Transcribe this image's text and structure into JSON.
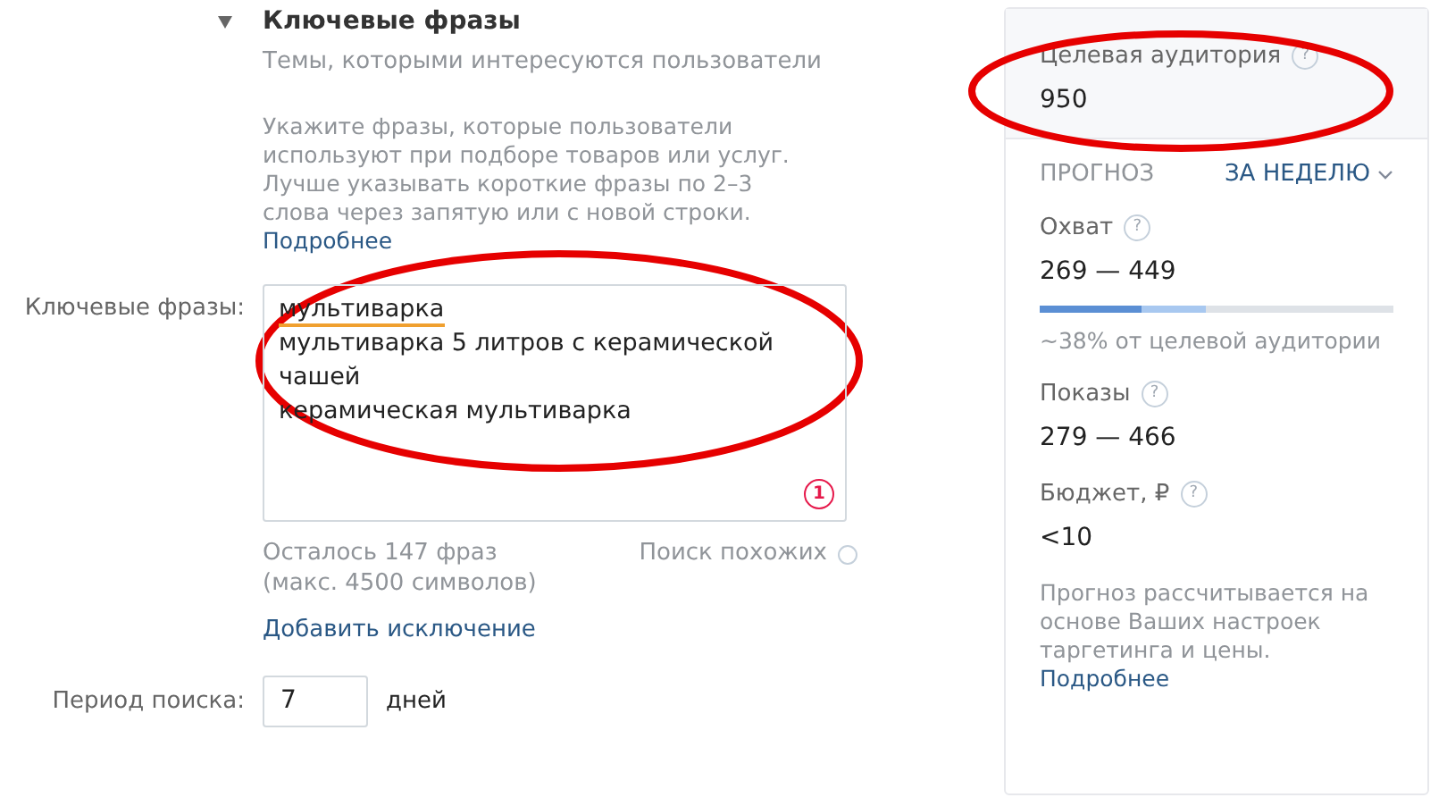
{
  "section": {
    "title": "Ключевые фразы",
    "expanded": true,
    "subtitle": "Темы, которыми интересуются пользователи",
    "hint": "Укажите фразы, которые пользователи используют при подборе товаров или услуг. Лучше указывать короткие фразы по 2–3 слова через запятую или с новой строки.",
    "hint_link": "Подробнее"
  },
  "keywords": {
    "label": "Ключевые фразы:",
    "circled": true,
    "phrases": [
      {
        "text": "мультиварка",
        "underlined": true
      },
      {
        "text": "мультиварка 5 литров с керамической чашей",
        "underlined": false
      },
      {
        "text": "керамическая мультиварка",
        "underlined": false
      }
    ],
    "counter": "1",
    "remaining": "Осталось 147 фраз",
    "limit": "(макс. 4500 символов)",
    "similar": {
      "label": "Поиск похожих",
      "checked": false
    },
    "add_exclusion": "Добавить исключение"
  },
  "period": {
    "label": "Период поиска:",
    "value": "7",
    "unit": "дней"
  },
  "audience": {
    "label": "Целевая аудитория",
    "help": "?",
    "value": "950",
    "circled": true
  },
  "forecast": {
    "title": "ПРОГНОЗ",
    "period": "ЗА НЕДЕЛЮ",
    "reach_label": "Охват",
    "reach_help": "?",
    "reach_value": "269 — 449",
    "bar_segments": [
      {
        "level": 0.29
      },
      {
        "level": 0.47
      }
    ],
    "reach_note": "~38% от целевой аудитории",
    "views_label": "Показы",
    "views_help": "?",
    "views_value": "279 — 466",
    "budget_label": "Бюджет, ₽",
    "budget_help": "?",
    "budget_value": "<10",
    "note": "Прогноз рассчитывается на основе Ваших настроек таргетинга и цены.",
    "note_link": "Подробнее"
  }
}
